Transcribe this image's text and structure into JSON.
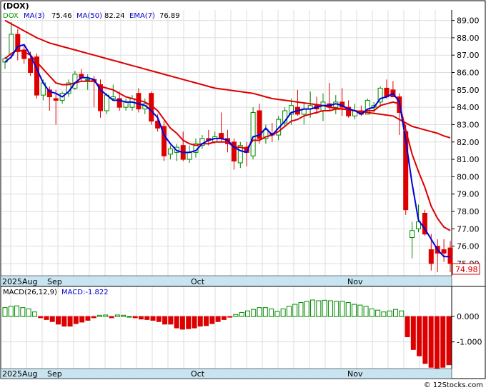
{
  "chart_data": [
    {
      "type": "candlestick",
      "title": "(DOX)",
      "legend": [
        {
          "label": "DOX",
          "color": "#009900"
        },
        {
          "label": "MA(3)",
          "value": "75.46",
          "color": "#0000cc"
        },
        {
          "label": "MA(50)",
          "value": "82.24",
          "color": "#0000cc"
        },
        {
          "label": "EMA(7)",
          "value": "76.89",
          "color": "#000000"
        }
      ],
      "ylim": [
        74.3,
        89.6
      ],
      "y_ticks": [
        "89.00",
        "88.00",
        "87.00",
        "86.00",
        "85.00",
        "84.00",
        "83.00",
        "82.00",
        "81.00",
        "80.00",
        "79.00",
        "78.00",
        "77.00",
        "76.00",
        "75.00"
      ],
      "last_price": "74.98",
      "x_labels": [
        "2025Aug",
        "Sep",
        "Oct",
        "Nov"
      ],
      "grid": true,
      "candles": [
        [
          86.6,
          86.9,
          86.2,
          86.8
        ],
        [
          87.0,
          88.9,
          86.8,
          88.2
        ],
        [
          88.2,
          88.5,
          86.7,
          87.2
        ],
        [
          87.3,
          87.6,
          86.5,
          86.8
        ],
        [
          86.8,
          87.2,
          85.8,
          86.0
        ],
        [
          86.9,
          87.1,
          84.5,
          84.7
        ],
        [
          84.7,
          85.6,
          84.4,
          85.4
        ],
        [
          85.0,
          85.2,
          83.8,
          84.6
        ],
        [
          84.5,
          85.0,
          83.0,
          84.4
        ],
        [
          84.4,
          84.9,
          84.2,
          84.8
        ],
        [
          84.8,
          85.6,
          84.6,
          85.4
        ],
        [
          85.1,
          86.1,
          85.0,
          85.9
        ],
        [
          85.9,
          86.2,
          85.5,
          85.7
        ],
        [
          85.6,
          85.9,
          85.0,
          85.6
        ],
        [
          85.6,
          85.8,
          84.0,
          85.5
        ],
        [
          85.3,
          85.6,
          83.4,
          83.8
        ],
        [
          83.8,
          84.8,
          83.6,
          84.7
        ],
        [
          84.5,
          85.3,
          84.4,
          84.6
        ],
        [
          84.5,
          84.9,
          83.8,
          84.0
        ],
        [
          84.0,
          84.5,
          83.8,
          84.3
        ],
        [
          84.0,
          84.7,
          83.8,
          84.5
        ],
        [
          84.8,
          85.1,
          83.7,
          83.9
        ],
        [
          83.9,
          84.5,
          83.6,
          84.2
        ],
        [
          84.8,
          84.9,
          83.0,
          83.2
        ],
        [
          83.2,
          83.6,
          82.6,
          82.8
        ],
        [
          82.9,
          83.2,
          80.9,
          81.2
        ],
        [
          81.3,
          81.8,
          81.0,
          81.6
        ],
        [
          81.4,
          81.9,
          80.9,
          81.7
        ],
        [
          81.8,
          82.6,
          80.9,
          81.0
        ],
        [
          81.0,
          81.8,
          80.8,
          81.4
        ],
        [
          81.4,
          82.2,
          81.1,
          81.9
        ],
        [
          81.8,
          82.4,
          81.6,
          82.2
        ],
        [
          82.2,
          82.7,
          81.8,
          82.1
        ],
        [
          82.0,
          82.6,
          81.9,
          82.3
        ],
        [
          82.5,
          83.7,
          82.0,
          82.2
        ],
        [
          82.2,
          82.7,
          81.4,
          81.9
        ],
        [
          82.0,
          82.2,
          80.4,
          80.9
        ],
        [
          80.8,
          82.0,
          80.5,
          81.8
        ],
        [
          81.7,
          82.0,
          80.6,
          81.4
        ],
        [
          81.2,
          84.0,
          81.0,
          83.7
        ],
        [
          83.8,
          84.2,
          81.9,
          82.2
        ],
        [
          82.2,
          83.0,
          81.9,
          82.7
        ],
        [
          82.5,
          83.1,
          82.0,
          82.4
        ],
        [
          82.4,
          83.5,
          82.1,
          83.3
        ],
        [
          83.1,
          84.0,
          82.9,
          83.8
        ],
        [
          83.6,
          84.5,
          83.0,
          84.1
        ],
        [
          84.0,
          85.0,
          83.5,
          83.6
        ],
        [
          83.6,
          84.3,
          83.0,
          83.9
        ],
        [
          83.9,
          84.9,
          83.4,
          84.1
        ],
        [
          84.1,
          84.6,
          83.6,
          83.9
        ],
        [
          83.8,
          84.8,
          83.2,
          84.3
        ],
        [
          84.2,
          85.4,
          83.8,
          84.0
        ],
        [
          84.0,
          84.7,
          83.6,
          84.3
        ],
        [
          84.3,
          85.1,
          83.5,
          84.0
        ],
        [
          84.0,
          84.4,
          83.4,
          83.5
        ],
        [
          83.5,
          84.2,
          83.3,
          83.8
        ],
        [
          83.8,
          84.1,
          83.5,
          83.6
        ],
        [
          83.6,
          84.5,
          83.6,
          84.4
        ],
        [
          84.0,
          84.3,
          83.7,
          84.1
        ],
        [
          84.3,
          85.2,
          84.0,
          85.1
        ],
        [
          85.1,
          85.6,
          84.5,
          84.6
        ],
        [
          85.0,
          85.5,
          84.6,
          84.6
        ],
        [
          84.6,
          84.8,
          82.4,
          83.7
        ],
        [
          82.6,
          83.0,
          77.8,
          78.1
        ],
        [
          76.5,
          77.4,
          75.3,
          76.9
        ],
        [
          77.0,
          78.4,
          76.8,
          77.4
        ],
        [
          77.9,
          78.1,
          76.6,
          76.7
        ],
        [
          75.8,
          76.7,
          74.6,
          75.0
        ],
        [
          76.0,
          76.4,
          74.5,
          75.6
        ],
        [
          75.8,
          76.4,
          75.1,
          75.6
        ],
        [
          75.9,
          76.3,
          74.5,
          75.0
        ]
      ],
      "series": [
        {
          "name": "MA(3)",
          "values": [
            86.6,
            86.9,
            87.5,
            87.6,
            87.0,
            86.2,
            85.4,
            84.9,
            84.8,
            84.6,
            84.9,
            85.4,
            85.7,
            85.7,
            85.6,
            85.0,
            84.7,
            84.4,
            84.4,
            84.3,
            84.3,
            84.2,
            84.1,
            83.8,
            83.4,
            82.4,
            81.9,
            81.5,
            81.4,
            81.4,
            81.5,
            81.9,
            82.1,
            82.2,
            82.2,
            82.1,
            81.7,
            81.5,
            81.4,
            82.3,
            82.4,
            82.8,
            82.4,
            82.8,
            83.2,
            83.7,
            83.8,
            83.9,
            83.9,
            84.0,
            84.1,
            84.1,
            84.2,
            84.1,
            83.9,
            83.8,
            83.6,
            83.9,
            84.0,
            84.5,
            84.6,
            84.8,
            84.3,
            82.1,
            79.6,
            77.5,
            77.0,
            76.4,
            75.8,
            75.4,
            75.4
          ]
        },
        {
          "name": "EMA(7)",
          "values": [
            86.8,
            87.1,
            87.3,
            87.2,
            87.0,
            86.6,
            86.2,
            85.8,
            85.4,
            85.3,
            85.3,
            85.4,
            85.5,
            85.5,
            85.5,
            85.2,
            85.1,
            85.0,
            84.8,
            84.6,
            84.5,
            84.4,
            84.3,
            84.1,
            83.8,
            83.3,
            82.8,
            82.5,
            82.1,
            81.9,
            81.8,
            81.9,
            81.9,
            82.0,
            82.0,
            82.0,
            81.7,
            81.7,
            81.6,
            82.1,
            82.1,
            82.3,
            82.4,
            82.6,
            82.9,
            83.2,
            83.3,
            83.5,
            83.6,
            83.7,
            83.8,
            83.8,
            83.9,
            83.9,
            83.9,
            83.8,
            83.7,
            83.8,
            83.8,
            84.1,
            84.2,
            84.3,
            84.2,
            82.7,
            81.3,
            80.3,
            79.4,
            78.3,
            77.6,
            77.1,
            76.9
          ]
        },
        {
          "name": "MA(50)",
          "values": [
            89.0,
            88.8,
            88.6,
            88.4,
            88.2,
            88.0,
            87.85,
            87.7,
            87.6,
            87.5,
            87.4,
            87.3,
            87.2,
            87.1,
            87.0,
            86.9,
            86.8,
            86.7,
            86.6,
            86.5,
            86.4,
            86.3,
            86.2,
            86.1,
            86.0,
            85.9,
            85.8,
            85.7,
            85.6,
            85.5,
            85.4,
            85.3,
            85.2,
            85.1,
            85.05,
            85.0,
            84.95,
            84.9,
            84.85,
            84.8,
            84.7,
            84.6,
            84.5,
            84.45,
            84.4,
            84.35,
            84.3,
            84.25,
            84.2,
            84.15,
            84.1,
            84.0,
            83.95,
            83.9,
            83.85,
            83.8,
            83.75,
            83.7,
            83.65,
            83.6,
            83.55,
            83.5,
            83.3,
            83.1,
            82.9,
            82.8,
            82.7,
            82.6,
            82.5,
            82.35,
            82.24
          ]
        }
      ]
    },
    {
      "type": "bar",
      "legend": [
        {
          "label": "MACD(26,12,9)",
          "color": "#000000"
        },
        {
          "label": "MACD:-1.822",
          "color": "#0000cc"
        }
      ],
      "ylim": [
        -2.05,
        0.65
      ],
      "y_ticks": [
        "0.000",
        "-1.000"
      ],
      "x_labels": [
        "2025Aug",
        "Sep",
        "Oct",
        "Nov"
      ],
      "values": [
        0.35,
        0.4,
        0.42,
        0.35,
        0.3,
        0.18,
        -0.05,
        -0.12,
        -0.2,
        -0.3,
        -0.38,
        -0.38,
        -0.28,
        -0.22,
        -0.15,
        -0.05,
        0.05,
        0.06,
        -0.05,
        0.06,
        0.05,
        0.0,
        -0.05,
        -0.1,
        -0.12,
        -0.15,
        -0.2,
        -0.3,
        -0.3,
        -0.45,
        -0.5,
        -0.48,
        -0.45,
        -0.38,
        -0.36,
        -0.28,
        -0.2,
        -0.12,
        -0.02,
        0.08,
        0.16,
        0.22,
        0.28,
        0.35,
        0.35,
        0.3,
        0.2,
        0.3,
        0.4,
        0.48,
        0.55,
        0.6,
        0.65,
        0.62,
        0.64,
        0.62,
        0.6,
        0.6,
        0.55,
        0.48,
        0.45,
        0.4,
        0.3,
        0.25,
        0.18,
        0.22,
        0.28,
        0.22,
        -0.8,
        -1.3,
        -1.55,
        -1.85,
        -2.0,
        -2.05,
        -2.0,
        -1.9
      ]
    }
  ],
  "watermark": "© 12Stocks.com"
}
